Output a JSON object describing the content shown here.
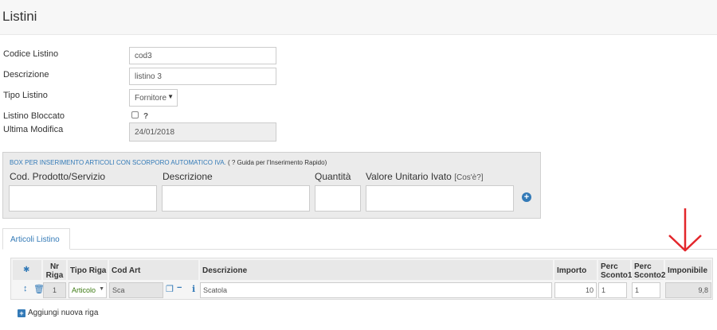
{
  "page": {
    "title": "Listini"
  },
  "form": {
    "codice_label": "Codice Listino",
    "codice_value": "cod3",
    "descrizione_label": "Descrizione",
    "descrizione_value": "listino 3",
    "tipo_label": "Tipo Listino",
    "tipo_value": "Fornitore",
    "bloccato_label": "Listino Bloccato",
    "bloccato_help": "?",
    "modifica_label": "Ultima Modifica",
    "modifica_value": "24/01/2018"
  },
  "quick_box": {
    "title": "BOX PER INSERIMENTO ARTICOLI CON SCORPORO AUTOMATICO IVA.",
    "guide": "( ? Guida per l'Inserimento Rapido)",
    "cod_label": "Cod. Prodotto/Servizio",
    "desc_label": "Descrizione",
    "qty_label": "Quantità",
    "price_label": "Valore Unitario Ivato",
    "price_hint": "[Cos'è?]"
  },
  "tabs": [
    {
      "label": "Articoli Listino"
    }
  ],
  "grid": {
    "headers": {
      "nr": "Nr Riga",
      "tipo": "Tipo Riga",
      "cod": "Cod Art",
      "desc": "Descrizione",
      "importo": "Importo",
      "sconto1": "Perc Sconto1",
      "sconto2": "Perc Sconto2",
      "imponibile": "Imponibile"
    },
    "rows": [
      {
        "nr": "1",
        "tipo": "Articolo",
        "cod": "Sca",
        "desc": "Scatola",
        "importo": "10",
        "sconto1": "1",
        "sconto2": "1",
        "imponibile": "9,8"
      }
    ],
    "add_label": "Aggiungi nuova riga"
  },
  "colors": {
    "accent": "#337ab7",
    "arrow": "#e3262b",
    "tipo_text": "#3c7a12"
  }
}
